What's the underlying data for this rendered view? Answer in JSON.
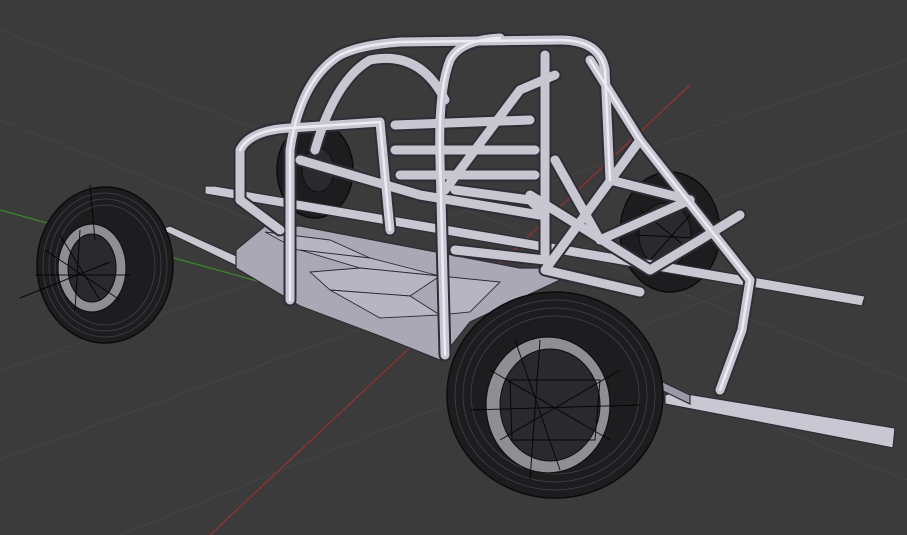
{
  "viewport": {
    "background_color": "#3b3b3b",
    "axis_x_color": "#9a3030",
    "axis_y_color": "#3a8a2a",
    "grid_color": "#444444"
  },
  "model": {
    "tube_color": "#c7c6d1",
    "tire_color": "#1d1d20",
    "rim_color": "#8e8e94"
  }
}
